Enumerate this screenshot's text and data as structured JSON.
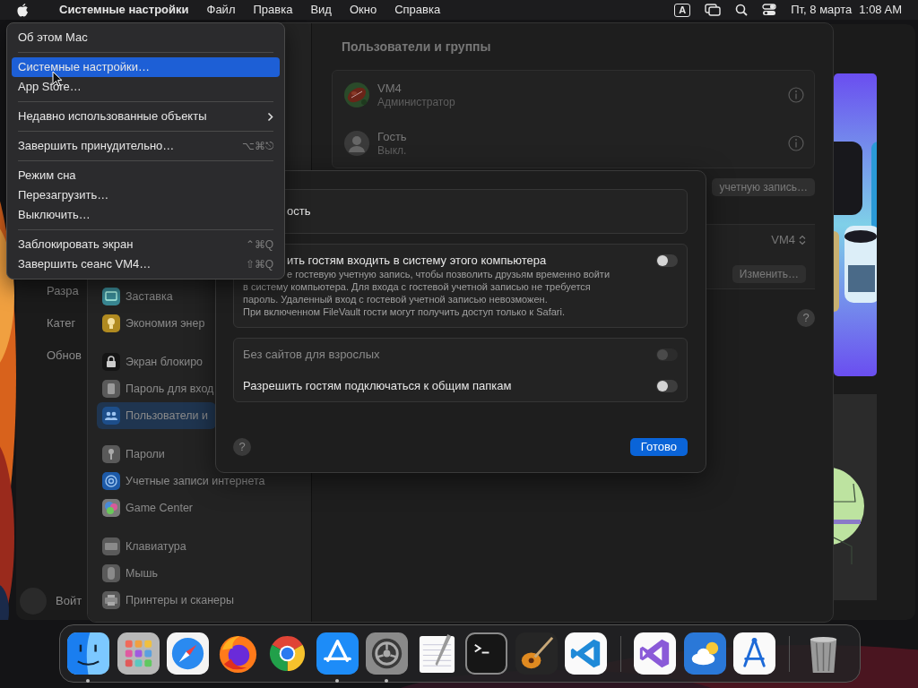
{
  "menu_bar": {
    "app_name": "Системные настройки",
    "menus": [
      "Файл",
      "Правка",
      "Вид",
      "Окно",
      "Справка"
    ],
    "input_source": "A",
    "date": "Пт, 8 марта",
    "time": "1:08 AM"
  },
  "apple_menu": {
    "items": [
      {
        "kind": "item",
        "label": "Об этом Mac",
        "selected": false
      },
      {
        "kind": "separator"
      },
      {
        "kind": "item",
        "label": "Системные настройки…",
        "selected": true
      },
      {
        "kind": "item",
        "label": "App Store…",
        "selected": false
      },
      {
        "kind": "separator"
      },
      {
        "kind": "submenu",
        "label": "Недавно использованные объекты",
        "selected": false
      },
      {
        "kind": "separator"
      },
      {
        "kind": "item",
        "label": "Завершить принудительно…",
        "shortcut": "⌥⌘⎋",
        "selected": false
      },
      {
        "kind": "separator"
      },
      {
        "kind": "item",
        "label": "Режим сна",
        "selected": false
      },
      {
        "kind": "item",
        "label": "Перезагрузить…",
        "selected": false
      },
      {
        "kind": "item",
        "label": "Выключить…",
        "selected": false
      },
      {
        "kind": "separator"
      },
      {
        "kind": "item",
        "label": "Заблокировать экран",
        "shortcut": "⌃⌘Q",
        "selected": false
      },
      {
        "kind": "item",
        "label": "Завершить сеанс VM4…",
        "shortcut": "⇧⌘Q",
        "selected": false
      }
    ]
  },
  "background_window": {
    "sidebar_items": [
      "Разра",
      "Катег",
      "Обнов"
    ],
    "account_label": "Войт"
  },
  "settings_window": {
    "sidebar_groups": [
      [
        {
          "kind": "screensaver",
          "label": "Заставка",
          "selected": false
        },
        {
          "kind": "energy",
          "label": "Экономия энер",
          "selected": false
        }
      ],
      [
        {
          "kind": "lock_screen",
          "label": "Экран блокиро",
          "selected": false
        },
        {
          "kind": "login_password",
          "label": "Пароль для вход",
          "selected": false
        },
        {
          "kind": "users",
          "label": "Пользователи и",
          "selected": true
        }
      ],
      [
        {
          "kind": "passwords",
          "label": "Пароли",
          "selected": false
        },
        {
          "kind": "internet_accounts",
          "label": "Учетные записи интернета",
          "selected": false
        },
        {
          "kind": "game_center",
          "label": "Game Center",
          "selected": false
        }
      ],
      [
        {
          "kind": "keyboard",
          "label": "Клавиатура",
          "selected": false
        },
        {
          "kind": "mouse",
          "label": "Мышь",
          "selected": false
        },
        {
          "kind": "printers",
          "label": "Принтеры и сканеры",
          "selected": false
        }
      ]
    ],
    "title": "Пользователи и группы",
    "users": [
      {
        "name": "VM4",
        "role": "Администратор"
      },
      {
        "kind": "guest",
        "name": "Гость",
        "role": "Выкл."
      }
    ],
    "add_button": "учетную запись…",
    "login_user": "VM4",
    "edit_button": "Изменить…",
    "help_label": "?"
  },
  "sheet": {
    "sections": [
      {
        "rows": [
          {
            "kind": "label",
            "label": "ость"
          }
        ]
      },
      {
        "rows": [
          {
            "kind": "toggle",
            "label": "ить гостям входить в систему этого компьютера",
            "on": false,
            "disabled": false,
            "partial_line": "е гостевую учетную запись, чтобы позволить друзьям временно войти",
            "description": "в систему компьютера. Для входа с гостевой учетной записью не требуется пароль. Удаленный вход с гостевой учетной записью невозможен.",
            "note": "При включенном FileVault гости могут получить доступ только к Safari."
          }
        ]
      },
      {
        "rows": [
          {
            "kind": "toggle",
            "label": "Без сайтов для взрослых",
            "on": false,
            "disabled": true
          },
          {
            "kind": "toggle",
            "label": "Разрешить гостям подключаться к общим папкам",
            "on": false,
            "disabled": false
          }
        ]
      }
    ],
    "help_label": "?",
    "done_button": "Готово"
  },
  "dock": {
    "groups": [
      [
        {
          "kind": "finder",
          "running": true
        },
        {
          "kind": "launchpad",
          "running": false
        },
        {
          "kind": "safari",
          "running": false
        },
        {
          "kind": "firefox",
          "running": false
        },
        {
          "kind": "chrome",
          "running": false
        },
        {
          "kind": "app_store",
          "running": true
        },
        {
          "kind": "settings",
          "running": true
        },
        {
          "kind": "textedit",
          "running": false
        },
        {
          "kind": "terminal",
          "running": false
        },
        {
          "kind": "garageband",
          "running": false
        },
        {
          "kind": "vscode",
          "running": false
        }
      ],
      [
        {
          "kind": "visual_studio",
          "running": false
        },
        {
          "kind": "weather",
          "running": false
        },
        {
          "kind": "drafting",
          "running": false
        }
      ],
      [
        {
          "kind": "trash",
          "running": false
        }
      ]
    ]
  }
}
